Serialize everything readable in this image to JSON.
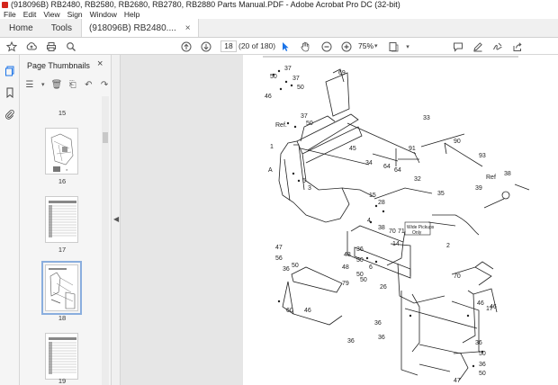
{
  "window": {
    "title": "(918096B) RB2480, RB2580, RB2680, RB2780, RB2880 Parts Manual.PDF - Adobe Acrobat Pro DC (32-bit)"
  },
  "menu": [
    "File",
    "Edit",
    "View",
    "Sign",
    "Window",
    "Help"
  ],
  "tabs": {
    "home": "Home",
    "tools": "Tools",
    "document": "(918096B) RB2480....",
    "close": "×"
  },
  "toolbar": {
    "page_current": "18",
    "page_count": "(20 of 180)",
    "zoom": "75%",
    "icons": [
      "bookmark-star-icon",
      "upload-icon",
      "print-icon",
      "search-icon",
      "page-up-icon",
      "page-down-icon",
      "select-arrow-icon",
      "hand-icon",
      "zoom-out-icon",
      "zoom-in-icon",
      "fit-page-icon",
      "comment-icon",
      "pen-icon",
      "sign-icon",
      "share-icon"
    ]
  },
  "sidebar": {
    "title": "Page Thumbnails",
    "close": "×",
    "thumbnails": [
      {
        "label": "15"
      },
      {
        "label": "16"
      },
      {
        "label": "17"
      },
      {
        "label": "18",
        "selected": true
      },
      {
        "label": "19"
      }
    ]
  },
  "drawing": {
    "callouts": [
      "37",
      "50",
      "37",
      "50",
      "69",
      "46",
      "Ref.",
      "37",
      "50",
      "33",
      "1",
      "45",
      "91",
      "90",
      "93",
      "A",
      "34",
      "64",
      "64",
      "32",
      "38",
      "5",
      "3",
      "39",
      "Ref",
      "35",
      "15",
      "28",
      "4",
      "38",
      "70",
      "71",
      "Wide Pickups",
      "Only",
      "14",
      "47",
      "36",
      "50",
      "48",
      "6",
      "56",
      "2",
      "48",
      "50",
      "79",
      "50",
      "36",
      "50",
      "26",
      "70",
      "46",
      "17",
      "60",
      "46",
      "36",
      "36",
      "36",
      "50",
      "36",
      "50",
      "46",
      "36",
      "47"
    ]
  }
}
